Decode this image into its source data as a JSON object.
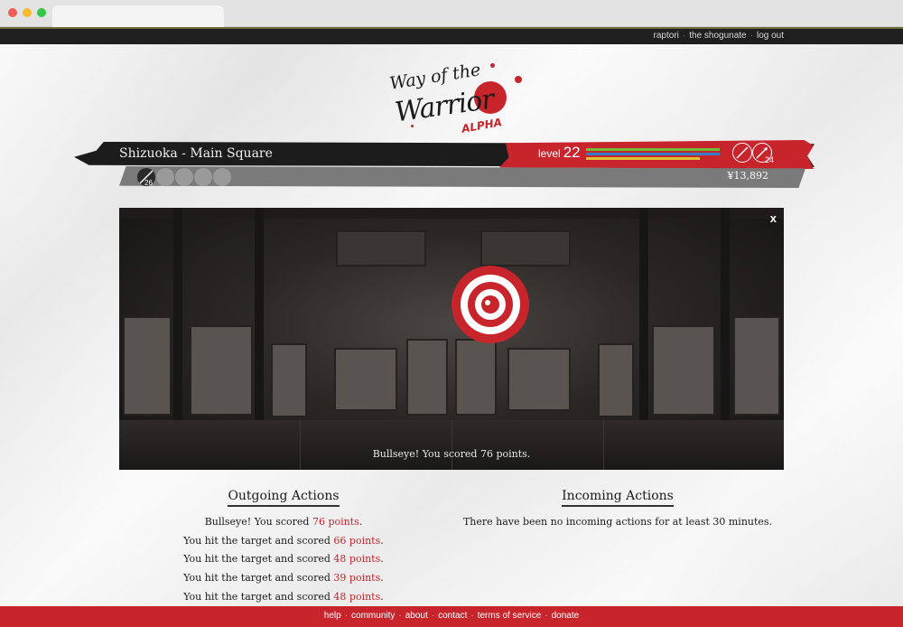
{
  "topnav": {
    "items": [
      "raptori",
      "the shogunate",
      "log out"
    ]
  },
  "logo": {
    "line1": "Way of the",
    "line2": "Warrior",
    "line3": "ALPHA"
  },
  "player": {
    "location": "Shizuoka - Main Square",
    "level_label": "level",
    "level": "22",
    "weapon_count": "24",
    "slot_count": "26",
    "money": "¥13,892"
  },
  "scene": {
    "close_label": "x",
    "result": "Bullseye! You scored 76 points."
  },
  "outgoing": {
    "title": "Outgoing Actions",
    "items": [
      {
        "pre": "Bullseye! You scored ",
        "pts": "76 points",
        "post": "."
      },
      {
        "pre": "You hit the target and scored ",
        "pts": "66 points",
        "post": "."
      },
      {
        "pre": "You hit the target and scored ",
        "pts": "48 points",
        "post": "."
      },
      {
        "pre": "You hit the target and scored ",
        "pts": "39 points",
        "post": "."
      },
      {
        "pre": "You hit the target and scored ",
        "pts": "48 points",
        "post": "."
      }
    ]
  },
  "incoming": {
    "title": "Incoming Actions",
    "message": "There have been no incoming actions for at least 30 minutes."
  },
  "footer": {
    "items": [
      "help",
      "community",
      "about",
      "contact",
      "terms of service",
      "donate"
    ]
  },
  "colors": {
    "accent_red": "#c8242c",
    "dark": "#1c1c1c"
  }
}
